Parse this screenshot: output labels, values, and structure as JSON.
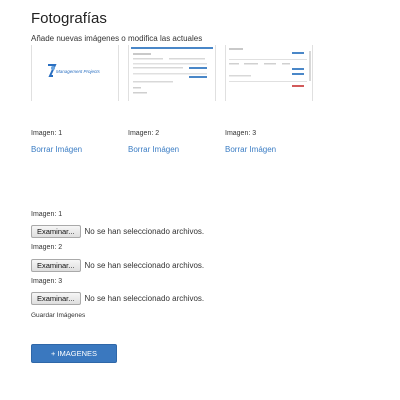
{
  "title": "Fotografías",
  "subtitle": "Añade nuevas imágenes o modifica las actuales",
  "thumbnails": [
    {
      "logo_text": "Management Projects"
    },
    {},
    {}
  ],
  "existing_images": [
    {
      "label": "Imagen: 1",
      "delete_label": "Borrar Imágen"
    },
    {
      "label": "Imagen: 2",
      "delete_label": "Borrar Imágen"
    },
    {
      "label": "Imagen: 3",
      "delete_label": "Borrar Imágen"
    }
  ],
  "uploads": [
    {
      "label": "Imagen: 1",
      "button_label": "Examinar...",
      "status": "No se han seleccionado archivos."
    },
    {
      "label": "Imagen: 2",
      "button_label": "Examinar...",
      "status": "No se han seleccionado archivos."
    },
    {
      "label": "Imagen: 3",
      "button_label": "Examinar...",
      "status": "No se han seleccionado archivos."
    }
  ],
  "save_label": "Guardar Imágenes",
  "submit_label": "+ IMAGENES",
  "colors": {
    "link": "#3b7dc4",
    "primary_button": "#3a78bf"
  }
}
